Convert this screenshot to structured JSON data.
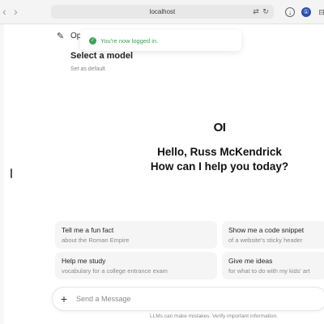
{
  "browser": {
    "back_glyph": "‹",
    "forward_glyph": "›",
    "url": "localhost",
    "translate_icon": "translate-icon",
    "reload_icon": "reload-icon",
    "download_icon": "download-icon",
    "password_icon": "password-manager-icon",
    "extension_icon": "extension-icon"
  },
  "header": {
    "new_chat_icon": "pencil-square-icon",
    "app_name": "Open WebUI",
    "model_selector": "Select a model",
    "set_default": "Set as default"
  },
  "toast": {
    "message": "You're now logged in.",
    "color": "#3aa35a"
  },
  "main": {
    "logo_text": "OI",
    "greeting_line1": "Hello, Russ McKendrick",
    "greeting_line2": "How can I help you today?"
  },
  "suggestions": [
    {
      "title": "Tell me a fun fact",
      "subtitle": "about the Roman Empire"
    },
    {
      "title": "Show me a code snippet",
      "subtitle": "of a website's sticky header"
    },
    {
      "title": "Help me study",
      "subtitle": "vocabulary for a college entrance exam"
    },
    {
      "title": "Give me ideas",
      "subtitle": "for what to do with my kids' art"
    }
  ],
  "input": {
    "add_glyph": "+",
    "placeholder": "Send a Message",
    "disclaimer": "LLMs can make mistakes. Verify important information."
  }
}
